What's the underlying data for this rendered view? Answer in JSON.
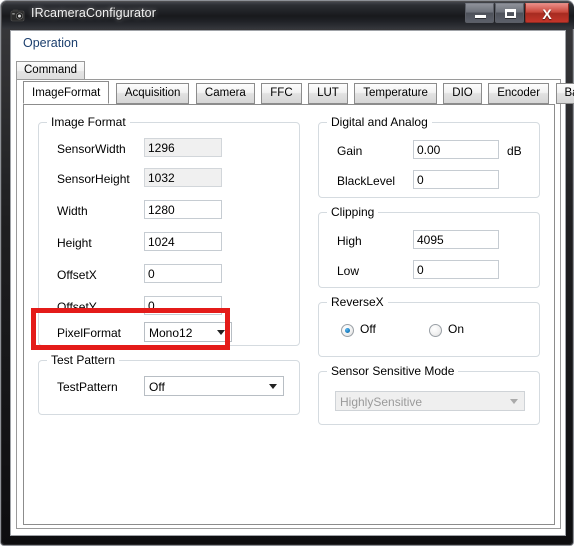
{
  "window": {
    "title": "IRcameraConfigurator",
    "icon": "camera-icon",
    "buttons": {
      "minimize": "minimize-icon",
      "maximize": "maximize-icon",
      "close": "X"
    }
  },
  "menubar": {
    "items": [
      "Operation"
    ]
  },
  "outer_tabs": [
    {
      "label": "Command",
      "selected": true
    }
  ],
  "inner_tabs": [
    {
      "label": "ImageFormat",
      "selected": true
    },
    {
      "label": "Acquisition",
      "selected": false
    },
    {
      "label": "Camera",
      "selected": false
    },
    {
      "label": "FFC",
      "selected": false
    },
    {
      "label": "LUT",
      "selected": false
    },
    {
      "label": "Temperature",
      "selected": false
    },
    {
      "label": "DIO",
      "selected": false
    },
    {
      "label": "Encoder",
      "selected": false
    },
    {
      "label": "Band Control",
      "selected": false
    }
  ],
  "groups": {
    "image_format": {
      "title": "Image Format",
      "fields": [
        {
          "label": "SensorWidth",
          "value": "1296",
          "type": "textbox",
          "disabled": true
        },
        {
          "label": "SensorHeight",
          "value": "1032",
          "type": "textbox",
          "disabled": true
        },
        {
          "label": "Width",
          "value": "1280",
          "type": "textbox",
          "disabled": false
        },
        {
          "label": "Height",
          "value": "1024",
          "type": "textbox",
          "disabled": false
        },
        {
          "label": "OffsetX",
          "value": "0",
          "type": "textbox",
          "disabled": false
        },
        {
          "label": "OffsetY",
          "value": "0",
          "type": "textbox",
          "disabled": false
        },
        {
          "label": "PixelFormat",
          "value": "Mono12",
          "type": "combobox",
          "disabled": false
        }
      ]
    },
    "test_pattern": {
      "title": "Test Pattern",
      "fields": [
        {
          "label": "TestPattern",
          "value": "Off",
          "type": "combobox",
          "disabled": false
        }
      ]
    },
    "digital_and_analog": {
      "title": "Digital and Analog",
      "fields": [
        {
          "label": "Gain",
          "value": "0.00",
          "type": "textbox",
          "disabled": false,
          "unit": "dB"
        },
        {
          "label": "BlackLevel",
          "value": "0",
          "type": "textbox",
          "disabled": false,
          "unit": ""
        }
      ]
    },
    "clipping": {
      "title": "Clipping",
      "fields": [
        {
          "label": "High",
          "value": "4095",
          "type": "textbox",
          "disabled": false
        },
        {
          "label": "Low",
          "value": "0",
          "type": "textbox",
          "disabled": false
        }
      ]
    },
    "reverse_x": {
      "title": "ReverseX",
      "options": [
        {
          "label": "Off",
          "checked": true
        },
        {
          "label": "On",
          "checked": false
        }
      ]
    },
    "sensor_sensitive_mode": {
      "title": "Sensor Sensitive Mode",
      "fields": [
        {
          "label": "",
          "value": "HighlySensitive",
          "type": "combobox",
          "disabled": true
        }
      ]
    }
  },
  "annotation": {
    "type": "red-rectangle-highlight",
    "target": "PixelFormat",
    "color": "#e41b19"
  }
}
